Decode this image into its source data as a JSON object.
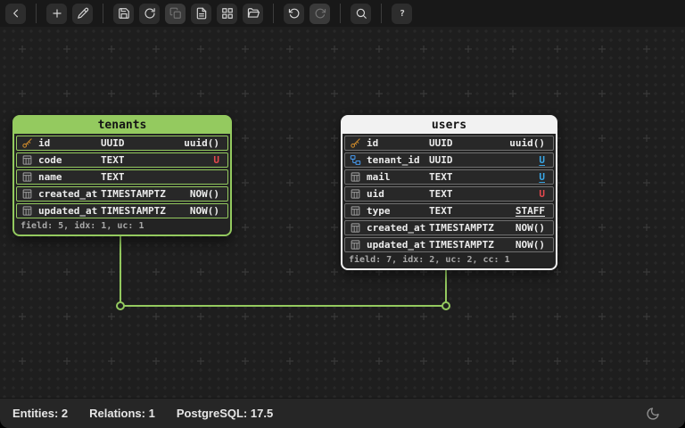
{
  "toolbar": {
    "items": [
      {
        "type": "button",
        "name": "back",
        "icon": "chevron-left"
      },
      {
        "type": "separator"
      },
      {
        "type": "button",
        "name": "add-table",
        "icon": "plus"
      },
      {
        "type": "button",
        "name": "edit",
        "icon": "pen"
      },
      {
        "type": "separator"
      },
      {
        "type": "button",
        "name": "save",
        "icon": "floppy"
      },
      {
        "type": "button",
        "name": "reload",
        "icon": "refresh"
      },
      {
        "type": "button",
        "name": "copy",
        "icon": "copy",
        "disabled": true
      },
      {
        "type": "button",
        "name": "export-document",
        "icon": "file-text"
      },
      {
        "type": "button",
        "name": "auto-layout",
        "icon": "grid"
      },
      {
        "type": "button",
        "name": "open-project",
        "icon": "folder-open"
      },
      {
        "type": "separator"
      },
      {
        "type": "button",
        "name": "undo",
        "icon": "undo"
      },
      {
        "type": "button",
        "name": "redo",
        "icon": "redo",
        "disabled": true
      },
      {
        "type": "separator"
      },
      {
        "type": "button",
        "name": "search",
        "icon": "magnifier"
      },
      {
        "type": "separator"
      },
      {
        "type": "button",
        "name": "help",
        "icon": "question"
      }
    ]
  },
  "tables": [
    {
      "name": "tenants",
      "accent": "#94ca5f",
      "row_border": "#94ca5f",
      "rows": [
        {
          "icon": "key",
          "name": "id",
          "type": "UUID",
          "extra": "uuid()",
          "extra_style": "plain"
        },
        {
          "icon": "column",
          "name": "code",
          "type": "TEXT",
          "extra": "U",
          "extra_style": "red"
        },
        {
          "icon": "column",
          "name": "name",
          "type": "TEXT",
          "extra": "",
          "extra_style": "plain"
        },
        {
          "icon": "column",
          "name": "created_at",
          "type": "TIMESTAMPTZ",
          "extra": "NOW()",
          "extra_style": "plain"
        },
        {
          "icon": "column",
          "name": "updated_at",
          "type": "TIMESTAMPTZ",
          "extra": "NOW()",
          "extra_style": "plain"
        }
      ],
      "footer": "field: 5, idx: 1, uc: 1"
    },
    {
      "name": "users",
      "accent": "#f2f2f2",
      "row_border": "#6f6f6f",
      "rows": [
        {
          "icon": "key",
          "name": "id",
          "type": "UUID",
          "extra": "uuid()",
          "extra_style": "plain"
        },
        {
          "icon": "fk",
          "name": "tenant_id",
          "type": "UUID",
          "extra": "U",
          "extra_style": "blue-underline"
        },
        {
          "icon": "column",
          "name": "mail",
          "type": "TEXT",
          "extra": "U",
          "extra_style": "blue-underline"
        },
        {
          "icon": "column",
          "name": "uid",
          "type": "TEXT",
          "extra": "U",
          "extra_style": "red"
        },
        {
          "icon": "column",
          "name": "type",
          "type": "TEXT",
          "extra": "STAFF",
          "extra_style": "white-underline"
        },
        {
          "icon": "column",
          "name": "created_at",
          "type": "TIMESTAMPTZ",
          "extra": "NOW()",
          "extra_style": "plain"
        },
        {
          "icon": "column",
          "name": "updated_at",
          "type": "TIMESTAMPTZ",
          "extra": "NOW()",
          "extra_style": "plain"
        }
      ],
      "footer": "field: 7, idx: 2, uc: 2, cc: 1"
    }
  ],
  "relation": {
    "from_table": "tenants",
    "to_table": "users",
    "from_cardinality": "one",
    "to_cardinality": "many"
  },
  "statusbar": {
    "entities": "Entities: 2",
    "relations": "Relations: 1",
    "engine": "PostgreSQL: 17.5"
  },
  "colors": {
    "accent_green": "#94ca5f",
    "users_header": "#f2f2f2",
    "badge_red": "#e5484d",
    "badge_blue": "#3aa7e6",
    "key_gold": "#c9872b",
    "fk_blue": "#4596e8",
    "column_gray": "#9a9a9a"
  }
}
